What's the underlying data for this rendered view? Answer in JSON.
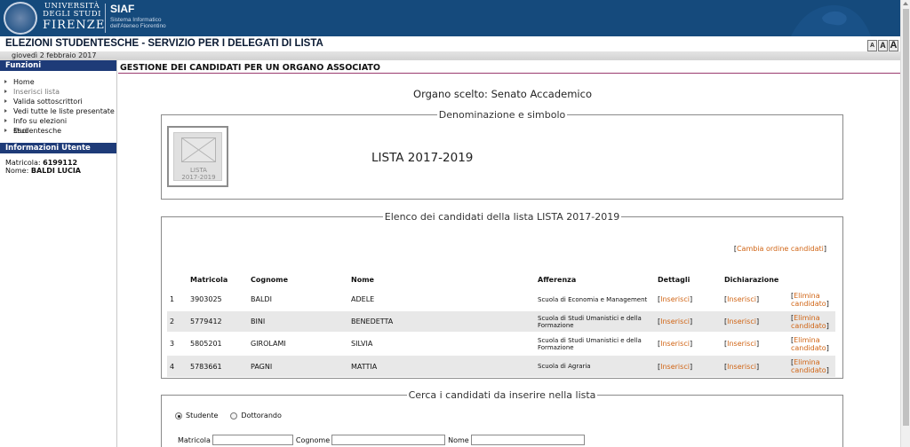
{
  "banner": {
    "university_lines": [
      "UNIVERSITÀ",
      "DEGLI STUDI",
      "FIRENZE"
    ],
    "siaf_title": "SIAF",
    "siaf_subtitle": "Sistema Informatico dell'Ateneo Fiorentino",
    "brand_color": "#154a7c"
  },
  "app": {
    "title": "ELEZIONI STUDENTESCHE - SERVIZIO PER I DELEGATI DI LISTA",
    "date": "giovedì 2 febbraio 2017",
    "font_size_buttons": [
      "A",
      "A",
      "A"
    ]
  },
  "sidebar": {
    "functions_header": "Funzioni",
    "items": [
      {
        "label": "Home",
        "current": false
      },
      {
        "label": "Inserisci lista",
        "current": true
      },
      {
        "label": "Valida sottoscrittori",
        "current": false
      },
      {
        "label": "Vedi tutte le liste presentate",
        "current": false
      },
      {
        "label": "Info su elezioni studentesche",
        "current": false
      },
      {
        "label": "Esci",
        "current": false
      }
    ],
    "user_header": "Informazioni Utente",
    "matricola_label": "Matricola:",
    "matricola_value": "6199112",
    "nome_label": "Nome:",
    "nome_value": "BALDI LUCIA"
  },
  "main": {
    "section_title": "GESTIONE DEI CANDIDATI PER UN ORGANO ASSOCIATO",
    "organo_scelto": "Organo scelto: Senato Accademico",
    "denominazione_legend": "Denominazione e simbolo",
    "logo_caption_1": "LISTA",
    "logo_caption_2": "2017-2019",
    "lista_name": "LISTA 2017-2019",
    "elenco_legend": "Elenco dei candidati della lista LISTA 2017-2019",
    "cambia_ordine": "Cambia ordine candidati",
    "table": {
      "headers": [
        "",
        "Matricola",
        "Cognome",
        "Nome",
        "Afferenza",
        "Dettagli",
        "Dichiarazione",
        ""
      ],
      "rows": [
        {
          "num": "1",
          "matricola": "3903025",
          "cognome": "BALDI",
          "nome": "ADELE",
          "afferenza": "Scuola di Economia e Management",
          "dettagli": "Inserisci",
          "dichiarazione": "Inserisci",
          "elimina": "Elimina candidato"
        },
        {
          "num": "2",
          "matricola": "5779412",
          "cognome": "BINI",
          "nome": "BENEDETTA",
          "afferenza": "Scuola di Studi Umanistici e della Formazione",
          "dettagli": "Inserisci",
          "dichiarazione": "Inserisci",
          "elimina": "Elimina candidato"
        },
        {
          "num": "3",
          "matricola": "5805201",
          "cognome": "GIROLAMI",
          "nome": "SILVIA",
          "afferenza": "Scuola di Studi Umanistici e della Formazione",
          "dettagli": "Inserisci",
          "dichiarazione": "Inserisci",
          "elimina": "Elimina candidato"
        },
        {
          "num": "4",
          "matricola": "5783661",
          "cognome": "PAGNI",
          "nome": "MATTIA",
          "afferenza": "Scuola di Agraria",
          "dettagli": "Inserisci",
          "dichiarazione": "Inserisci",
          "elimina": "Elimina candidato"
        }
      ]
    },
    "cerca_legend": "Cerca i candidati da inserire nella lista",
    "radio_studente": "Studente",
    "radio_dottorando": "Dottorando",
    "matricola_label": "Matricola",
    "cognome_label": "Cognome",
    "nome_label": "Nome",
    "link_color": "#d06414"
  }
}
